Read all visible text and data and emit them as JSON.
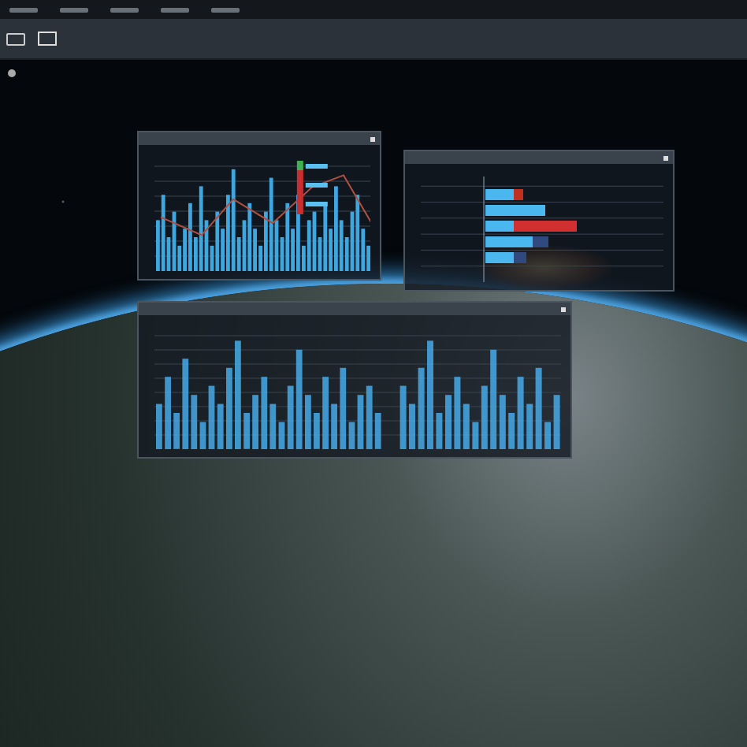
{
  "panels": [
    {
      "kind": "combo"
    },
    {
      "kind": "hbar"
    },
    {
      "kind": "bars"
    }
  ]
}
